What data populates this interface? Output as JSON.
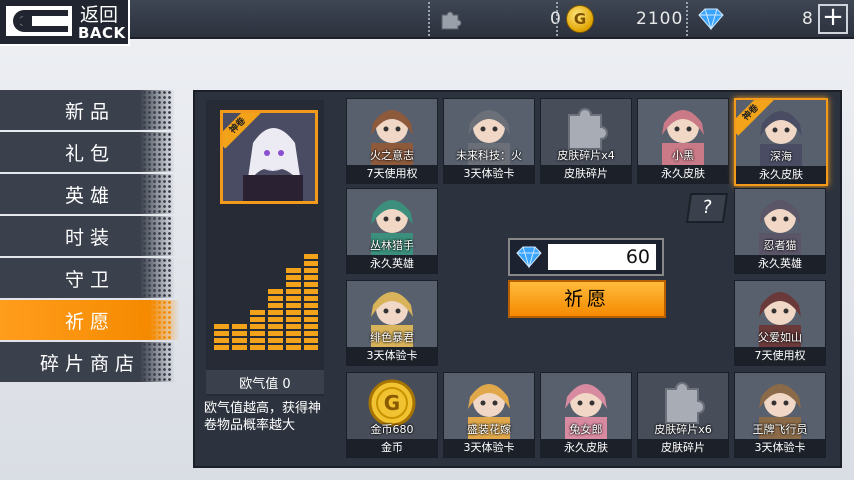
{
  "back": {
    "zh": "返回",
    "en": "BACK"
  },
  "resources": {
    "fragments": "0",
    "coins": "2100",
    "gems": "8",
    "coin_symbol": "G"
  },
  "nav": {
    "items": [
      "新品",
      "礼包",
      "英雄",
      "时装",
      "守卫",
      "祈愿",
      "碎片商店"
    ],
    "active_index": 5
  },
  "luck": {
    "badge": "神卷",
    "label": "欧气值 0",
    "note": "欧气值越高，获得神卷物品概率越大",
    "level": 0.6
  },
  "help_label": "?",
  "cost": {
    "value": "60"
  },
  "pray_label": "祈愿",
  "cards": [
    {
      "name": "火之意志",
      "sub": "7天使用权",
      "art": "char"
    },
    {
      "name": "未来科技：火",
      "sub": "3天体验卡",
      "art": "char"
    },
    {
      "name": "皮肤碎片x4",
      "sub": "皮肤碎片",
      "art": "puzzle"
    },
    {
      "name": "小黑",
      "sub": "永久皮肤",
      "art": "char"
    },
    {
      "name": "深海",
      "sub": "永久皮肤",
      "art": "char",
      "badge": "神卷",
      "selected": true
    },
    {
      "name": "丛林猎手",
      "sub": "永久英雄",
      "art": "char"
    },
    {
      "name": "忍者猫",
      "sub": "永久英雄",
      "art": "char"
    },
    {
      "name": "绯色暴君",
      "sub": "3天体验卡",
      "art": "char"
    },
    {
      "name": "父爱如山",
      "sub": "7天使用权",
      "art": "char"
    },
    {
      "name": "金币680",
      "sub": "金币",
      "art": "coin"
    },
    {
      "name": "盛装花嫁",
      "sub": "3天体验卡",
      "art": "char"
    },
    {
      "name": "兔女郎",
      "sub": "永久皮肤",
      "art": "char"
    },
    {
      "name": "皮肤碎片x6",
      "sub": "皮肤碎片",
      "art": "puzzle"
    },
    {
      "name": "王牌飞行员",
      "sub": "3天体验卡",
      "art": "char"
    }
  ],
  "colors": {
    "accent": "#f58a00",
    "panel": "#2d333e",
    "bar_on": "#f3a319"
  }
}
